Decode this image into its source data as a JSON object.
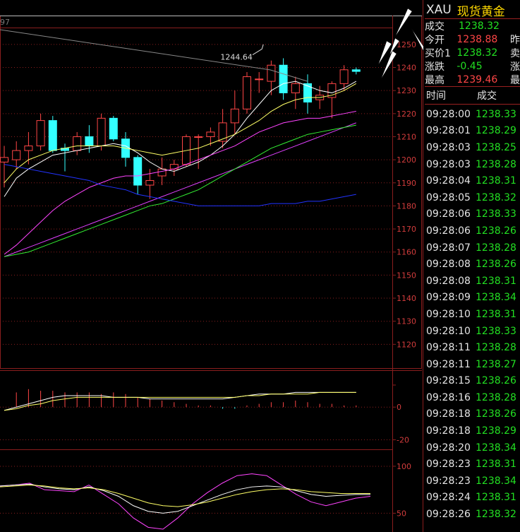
{
  "chart_data": [
    {
      "type": "candlestick",
      "panel": "price",
      "ylim": [
        1110,
        1257
      ],
      "yticks": [
        1120,
        1130,
        1140,
        1150,
        1160,
        1170,
        1180,
        1190,
        1200,
        1210,
        1220,
        1230,
        1240,
        1250
      ],
      "top_partial_tick": "97",
      "annotation": "1244.64",
      "candles": [
        {
          "o": 1199,
          "h": 1206,
          "l": 1188,
          "c": 1201
        },
        {
          "o": 1200,
          "h": 1208,
          "l": 1196,
          "c": 1204
        },
        {
          "o": 1204,
          "h": 1212,
          "l": 1198,
          "c": 1206
        },
        {
          "o": 1206,
          "h": 1220,
          "l": 1204,
          "c": 1217
        },
        {
          "o": 1217,
          "h": 1219,
          "l": 1203,
          "c": 1204
        },
        {
          "o": 1205,
          "h": 1207,
          "l": 1195,
          "c": 1204
        },
        {
          "o": 1204,
          "h": 1212,
          "l": 1202,
          "c": 1210
        },
        {
          "o": 1210,
          "h": 1215,
          "l": 1203,
          "c": 1206
        },
        {
          "o": 1206,
          "h": 1220,
          "l": 1204,
          "c": 1218
        },
        {
          "o": 1218,
          "h": 1219,
          "l": 1208,
          "c": 1209
        },
        {
          "o": 1209,
          "h": 1212,
          "l": 1197,
          "c": 1201
        },
        {
          "o": 1201,
          "h": 1202,
          "l": 1185,
          "c": 1189
        },
        {
          "o": 1189,
          "h": 1196,
          "l": 1183,
          "c": 1191
        },
        {
          "o": 1193,
          "h": 1201,
          "l": 1189,
          "c": 1196
        },
        {
          "o": 1196,
          "h": 1200,
          "l": 1193,
          "c": 1198
        },
        {
          "o": 1198,
          "h": 1211,
          "l": 1197,
          "c": 1210
        },
        {
          "o": 1210,
          "h": 1211,
          "l": 1196,
          "c": 1210
        },
        {
          "o": 1210,
          "h": 1214,
          "l": 1206,
          "c": 1212
        },
        {
          "o": 1208,
          "h": 1222,
          "l": 1205,
          "c": 1216
        },
        {
          "o": 1216,
          "h": 1230,
          "l": 1211,
          "c": 1222
        },
        {
          "o": 1222,
          "h": 1238,
          "l": 1220,
          "c": 1236
        },
        {
          "o": 1235,
          "h": 1238,
          "l": 1229,
          "c": 1235
        },
        {
          "o": 1234,
          "h": 1243,
          "l": 1228,
          "c": 1241
        },
        {
          "o": 1241,
          "h": 1244,
          "l": 1226,
          "c": 1229
        },
        {
          "o": 1229,
          "h": 1236,
          "l": 1222,
          "c": 1233
        },
        {
          "o": 1233,
          "h": 1237,
          "l": 1220,
          "c": 1225
        },
        {
          "o": 1226,
          "h": 1232,
          "l": 1222,
          "c": 1228
        },
        {
          "o": 1227,
          "h": 1234,
          "l": 1218,
          "c": 1233
        },
        {
          "o": 1233,
          "h": 1241,
          "l": 1230,
          "c": 1239
        },
        {
          "o": 1239,
          "h": 1240,
          "l": 1237,
          "c": 1238.3
        }
      ],
      "moving_averages": [
        {
          "color": "#ffffff",
          "values": [
            1184,
            1192,
            1196,
            1199,
            1202,
            1203,
            1204,
            1205,
            1206,
            1207,
            1206,
            1203,
            1199,
            1196,
            1195,
            1197,
            1199,
            1202,
            1206,
            1211,
            1218,
            1224,
            1230,
            1233,
            1234,
            1232,
            1230,
            1229,
            1231,
            1234
          ]
        },
        {
          "color": "#ffff66",
          "values": [
            1190,
            1196,
            1200,
            1202,
            1204,
            1205,
            1206,
            1206,
            1206,
            1206,
            1205,
            1204,
            1203,
            1202,
            1203,
            1204,
            1205,
            1207,
            1209,
            1211,
            1214,
            1217,
            1221,
            1224,
            1226,
            1227,
            1227,
            1228,
            1230,
            1233
          ]
        },
        {
          "color": "#ff44ff",
          "values": [
            1159,
            1163,
            1168,
            1173,
            1178,
            1182,
            1185,
            1188,
            1190,
            1192,
            1193,
            1193,
            1194,
            1195,
            1196,
            1198,
            1200,
            1202,
            1204,
            1206,
            1209,
            1212,
            1214,
            1216,
            1217,
            1218,
            1218,
            1219,
            1220,
            1221
          ]
        },
        {
          "color": "#e040ff",
          "values": [
            1158,
            1160,
            1162,
            1164,
            1166,
            1168,
            1170,
            1172,
            1174,
            1176,
            1178,
            1180,
            1182,
            1184,
            1186,
            1188,
            1190,
            1192,
            1194,
            1196,
            1198,
            1200,
            1202,
            1204,
            1206,
            1208,
            1210,
            1212,
            1214,
            1216
          ]
        },
        {
          "color": "#33ee33",
          "values": [
            1158,
            1159,
            1160,
            1162,
            1164,
            1166,
            1168,
            1170,
            1172,
            1174,
            1176,
            1178,
            1180,
            1181,
            1183,
            1185,
            1187,
            1190,
            1193,
            1196,
            1199,
            1202,
            1205,
            1207,
            1209,
            1211,
            1212,
            1213,
            1214,
            1215
          ]
        },
        {
          "color": "#2233ff",
          "values": [
            1198,
            1197,
            1196,
            1195,
            1194,
            1193,
            1192,
            1191,
            1189,
            1188,
            1187,
            1185,
            1184,
            1183,
            1182,
            1181,
            1180,
            1180,
            1180,
            1180,
            1180,
            1180,
            1181,
            1181,
            1181,
            1182,
            1182,
            1183,
            1184,
            1185
          ]
        }
      ]
    },
    {
      "type": "bar",
      "panel": "macd",
      "ylim": [
        -25,
        20
      ],
      "yticks": [
        0,
        -20
      ],
      "histogram": [
        0,
        9,
        11,
        10,
        10,
        9,
        9,
        9,
        8,
        9,
        8,
        6,
        5,
        4,
        3,
        2,
        1,
        1,
        -1,
        -1,
        1,
        2,
        3,
        3,
        4,
        3,
        2,
        2,
        1,
        1
      ],
      "lines": [
        {
          "color": "#ffffff",
          "values": [
            -2,
            0,
            2,
            4,
            6,
            7,
            7,
            7,
            7,
            6,
            6,
            6,
            5,
            5,
            5,
            5,
            5,
            5,
            5,
            6,
            7,
            8,
            8,
            8,
            9,
            9,
            9,
            9,
            9,
            9
          ]
        },
        {
          "color": "#ffff66",
          "values": [
            -2,
            -1,
            1,
            2,
            4,
            5,
            6,
            6,
            6,
            6,
            6,
            6,
            6,
            6,
            6,
            6,
            6,
            6,
            6,
            6,
            7,
            7,
            8,
            8,
            8,
            8,
            9,
            9,
            9,
            9
          ]
        }
      ]
    },
    {
      "type": "line",
      "panel": "kdj",
      "ylim": [
        30,
        115
      ],
      "yticks": [
        100,
        50
      ],
      "lines": [
        {
          "color": "#ff44ff",
          "values": [
            79,
            80,
            82,
            75,
            74,
            73,
            80,
            70,
            60,
            45,
            35,
            33,
            45,
            60,
            72,
            82,
            90,
            92,
            90,
            80,
            70,
            62,
            58,
            62,
            66,
            68
          ]
        },
        {
          "color": "#ffffff",
          "values": [
            79,
            80,
            81,
            78,
            76,
            75,
            78,
            74,
            68,
            58,
            52,
            50,
            52,
            58,
            64,
            70,
            75,
            78,
            79,
            78,
            74,
            70,
            68,
            69,
            70,
            70
          ]
        },
        {
          "color": "#ffff66",
          "values": [
            78,
            79,
            80,
            79,
            77,
            76,
            77,
            75,
            71,
            66,
            61,
            58,
            57,
            59,
            62,
            66,
            70,
            73,
            75,
            76,
            75,
            73,
            72,
            71,
            71,
            71
          ]
        }
      ]
    }
  ],
  "quote": {
    "symbol": "XAU",
    "name": "现货黄金",
    "rows": [
      {
        "label": "成交",
        "value": "1238.32",
        "color": "down",
        "extra": ""
      },
      {
        "label": "今开",
        "value": "1238.88",
        "color": "up",
        "extra": "昨"
      },
      {
        "label": "买价1",
        "value": "1238.32",
        "color": "down",
        "extra": "卖"
      },
      {
        "label": "涨跌",
        "value": "-0.45",
        "color": "down",
        "extra": "涨"
      },
      {
        "label": "最高",
        "value": "1239.46",
        "color": "up",
        "extra": "最"
      }
    ]
  },
  "ticks": {
    "header_time": "时间",
    "header_price": "成交",
    "rows": [
      {
        "time": "09:28:00",
        "price": "1238.33"
      },
      {
        "time": "09:28:01",
        "price": "1238.29"
      },
      {
        "time": "09:28:03",
        "price": "1238.25"
      },
      {
        "time": "09:28:03",
        "price": "1238.28"
      },
      {
        "time": "09:28:04",
        "price": "1238.31"
      },
      {
        "time": "09:28:05",
        "price": "1238.32"
      },
      {
        "time": "09:28:06",
        "price": "1238.33"
      },
      {
        "time": "09:28:06",
        "price": "1238.26"
      },
      {
        "time": "09:28:07",
        "price": "1238.28"
      },
      {
        "time": "09:28:08",
        "price": "1238.26"
      },
      {
        "time": "09:28:08",
        "price": "1238.31"
      },
      {
        "time": "09:28:09",
        "price": "1238.34"
      },
      {
        "time": "09:28:10",
        "price": "1238.31"
      },
      {
        "time": "09:28:10",
        "price": "1238.33"
      },
      {
        "time": "09:28:11",
        "price": "1238.28"
      },
      {
        "time": "09:28:11",
        "price": "1238.27"
      },
      {
        "time": "09:28:15",
        "price": "1238.26"
      },
      {
        "time": "09:28:16",
        "price": "1238.28"
      },
      {
        "time": "09:28:18",
        "price": "1238.26"
      },
      {
        "time": "09:28:18",
        "price": "1238.29"
      },
      {
        "time": "09:28:20",
        "price": "1238.34"
      },
      {
        "time": "09:28:23",
        "price": "1238.31"
      },
      {
        "time": "09:28:23",
        "price": "1238.34"
      },
      {
        "time": "09:28:24",
        "price": "1238.31"
      },
      {
        "time": "09:28:26",
        "price": "1238.32"
      }
    ]
  },
  "colors": {
    "up": "#ff4646",
    "down": "#33ffff",
    "grid": "#8a1e1e",
    "axis_text": "#d23c3c"
  }
}
